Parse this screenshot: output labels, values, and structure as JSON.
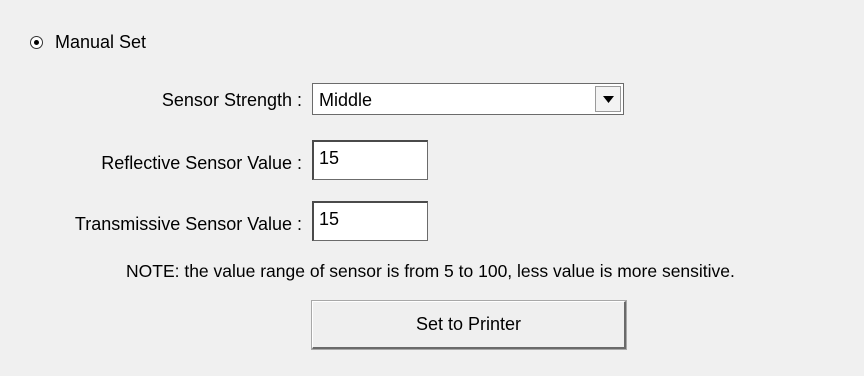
{
  "mode": {
    "label": "Manual Set",
    "selected": true
  },
  "sensor_strength": {
    "label": "Sensor Strength :",
    "value": "Middle"
  },
  "reflective": {
    "label": "Reflective Sensor Value :",
    "value": "15"
  },
  "transmissive": {
    "label": "Transmissive Sensor Value :",
    "value": "15"
  },
  "note": "NOTE: the value range of sensor is from 5 to 100, less value is more sensitive.",
  "set_button": {
    "label": "Set to Printer"
  },
  "icons": {
    "radio": "radio-selected-icon",
    "dropdown": "chevron-down-icon"
  }
}
